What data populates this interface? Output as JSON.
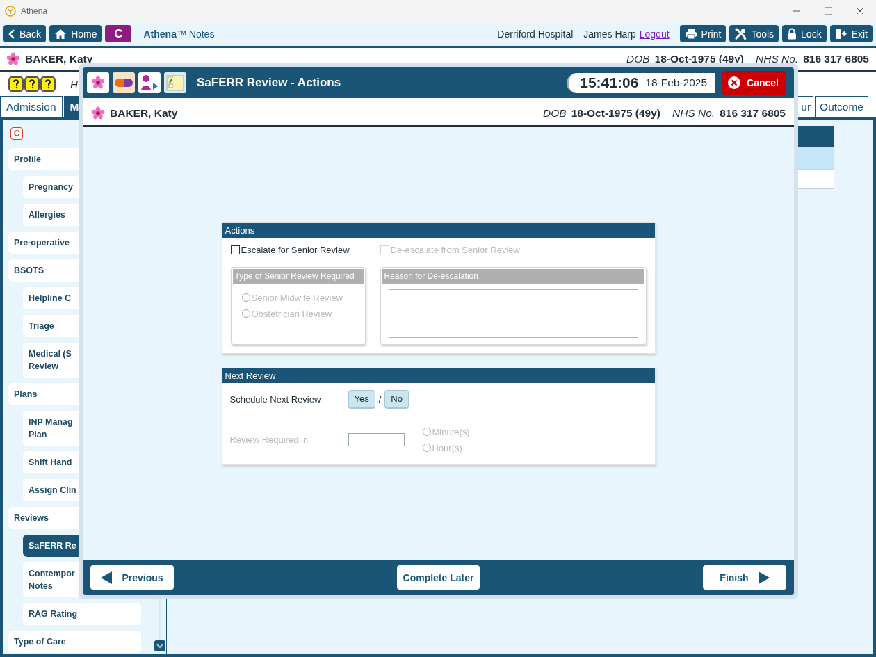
{
  "window": {
    "title": "Athena"
  },
  "toolbar": {
    "nav_buttons": [
      "Back",
      "Home"
    ],
    "app_badge": "C",
    "app_name": "**Athena**™ Notes",
    "location": "Derriford Hospital",
    "user": "James Harp",
    "logout": "Logout",
    "action_buttons": [
      "Print",
      "Tools",
      "Lock",
      "Exit"
    ]
  },
  "patient": {
    "name": "BAKER, Katy",
    "dob_label": "DOB",
    "dob": "18-Oct-1975 (49y)",
    "nhs_label": "NHS No.",
    "nhs": "816 317 6805"
  },
  "alert_row": {
    "text": "H"
  },
  "tabs": [
    {
      "label": "Admission",
      "selected": false
    },
    {
      "label": "M",
      "selected": true
    },
    {
      "label": "ur",
      "selected": false
    },
    {
      "label": "Outcome",
      "selected": false
    }
  ],
  "sidebar": {
    "badge": "C",
    "items": [
      {
        "label": "Profile",
        "selected": false,
        "children": [
          {
            "label": "Pregnancy",
            "selected": false
          },
          {
            "label": "Allergies",
            "selected": false
          }
        ]
      },
      {
        "label": "Pre-operative",
        "selected": false
      },
      {
        "label": "BSOTS",
        "selected": false,
        "children": [
          {
            "label": "Helpline C",
            "selected": false
          },
          {
            "label": "Triage",
            "selected": false
          },
          {
            "label": "Medical (S\nReview",
            "selected": false
          }
        ]
      },
      {
        "label": "Plans",
        "selected": false,
        "children": [
          {
            "label": "INP Manag\nPlan",
            "selected": false
          },
          {
            "label": "Shift Hand",
            "selected": false
          },
          {
            "label": "Assign Clin",
            "selected": false
          }
        ]
      },
      {
        "label": "Reviews",
        "selected": false,
        "children": [
          {
            "label": "SaFERR Re",
            "selected": true
          },
          {
            "label": "Contempor\nNotes",
            "selected": false
          },
          {
            "label": "RAG Rating",
            "selected": false
          }
        ]
      },
      {
        "label": "Type of Care",
        "selected": false
      }
    ]
  },
  "dialog": {
    "title": "SaFERR Review - Actions",
    "time": "15:41:06",
    "date": "18-Feb-2025",
    "cancel": "Cancel",
    "patient": {
      "name": "BAKER, Katy",
      "dob_label": "DOB",
      "dob": "18-Oct-1975 (49y)",
      "nhs_label": "NHS No.",
      "nhs": "816 317 6805"
    },
    "actions": {
      "title": "Actions",
      "checkboxes": [
        {
          "label": "Escalate for Senior Review",
          "checked": false,
          "disabled": false
        },
        {
          "label": "De-escalate from Senior Review",
          "checked": false,
          "disabled": true
        }
      ],
      "review_type": {
        "title": "Type of Senior Review Required",
        "disabled": true,
        "options": [
          {
            "label": "Senior Midwife Review",
            "selected": false
          },
          {
            "label": "Obstetrician Review",
            "selected": false
          }
        ]
      },
      "reason": {
        "title": "Reason for De-escalation",
        "disabled": true
      }
    },
    "next_review": {
      "title": "Next Review",
      "schedule_label": "Schedule Next Review",
      "choices": [
        {
          "label": "Yes",
          "selected": false
        },
        {
          "label": "No",
          "selected": false
        }
      ],
      "separator": "/",
      "required_label": "Review Required in",
      "disabled": true,
      "units": [
        {
          "label": "Minute(s)",
          "selected": false
        },
        {
          "label": "Hour(s)",
          "selected": false
        }
      ]
    },
    "footer": {
      "previous": "Previous",
      "later": "Complete Later",
      "finish": "Finish"
    }
  }
}
